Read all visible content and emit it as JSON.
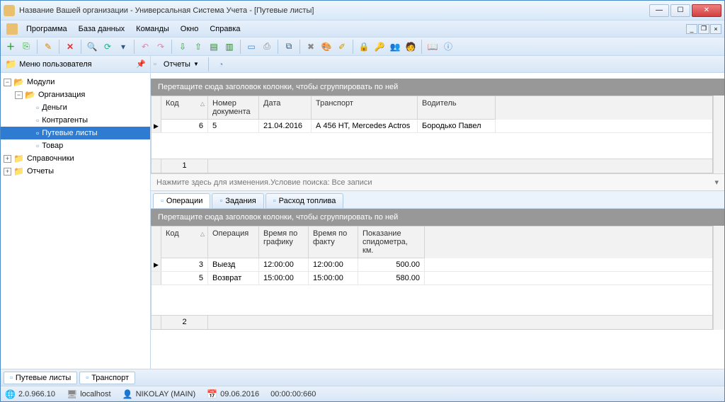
{
  "window": {
    "title": "Название Вашей организации - Универсальная Система Учета - [Путевые листы]"
  },
  "menu": {
    "program": "Программа",
    "database": "База данных",
    "commands": "Команды",
    "window": "Окно",
    "help": "Справка"
  },
  "sidebar": {
    "header": "Меню пользователя",
    "modules": "Модули",
    "org": "Организация",
    "money": "Деньги",
    "contr": "Контрагенты",
    "waybills": "Путевые листы",
    "goods": "Товар",
    "refs": "Справочники",
    "reports": "Отчеты"
  },
  "reportbar": {
    "reports": "Отчеты"
  },
  "groupbar_text": "Перетащите сюда заголовок колонки, чтобы сгруппировать по ней",
  "main_grid": {
    "headers": {
      "code": "Код",
      "docnum": "Номер документа",
      "date": "Дата",
      "transport": "Транспорт",
      "driver": "Водитель"
    },
    "row": {
      "code": "6",
      "docnum": "5",
      "date": "21.04.2016",
      "transport": "А 456 НТ, Mercedes Actros",
      "driver": "Бородько Павел"
    },
    "footer_count": "1"
  },
  "filter_line": {
    "a": "Нажмите здесь для изменения. ",
    "b": "Условие поиска: Все записи"
  },
  "detail_tabs": {
    "ops": "Операции",
    "tasks": "Задания",
    "fuel": "Расход топлива"
  },
  "detail_grid": {
    "headers": {
      "code": "Код",
      "op": "Операция",
      "t_sched": "Время по графику",
      "t_fact": "Время по факту",
      "odo": "Показание спидометра, км."
    },
    "rows": [
      {
        "code": "3",
        "op": "Выезд",
        "t_sched": "12:00:00",
        "t_fact": "12:00:00",
        "odo": "500.00"
      },
      {
        "code": "5",
        "op": "Возврат",
        "t_sched": "15:00:00",
        "t_fact": "15:00:00",
        "odo": "580.00"
      }
    ],
    "footer_count": "2"
  },
  "doc_tabs": {
    "waybills": "Путевые листы",
    "transport": "Транспорт"
  },
  "status": {
    "ver": "2.0.966.10",
    "host": "localhost",
    "user": "NIKOLAY (MAIN)",
    "date": "09.06.2016",
    "time": "00:00:00:660"
  }
}
